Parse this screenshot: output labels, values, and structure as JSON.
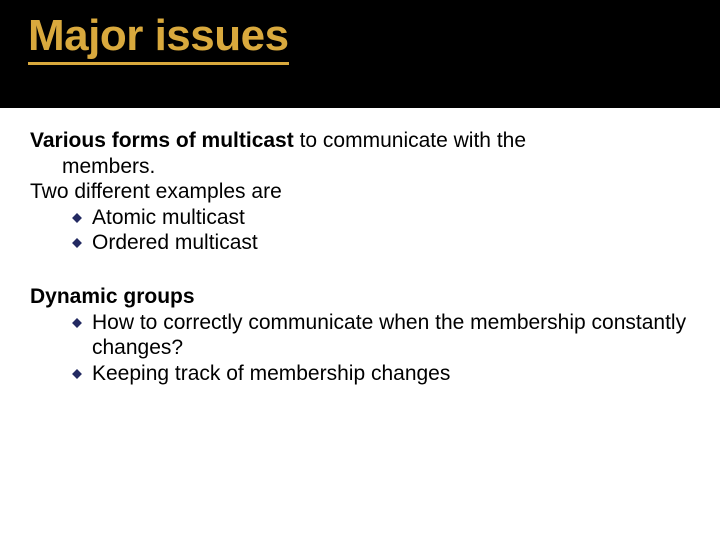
{
  "title": "Major issues",
  "section1": {
    "lead_bold": "Various forms of multicast",
    "lead_rest": " to communicate with the",
    "line2_indent": "members.",
    "line3": "Two different examples are",
    "bullets": [
      "Atomic multicast",
      "Ordered multicast"
    ]
  },
  "section2": {
    "heading": "Dynamic groups",
    "bullets": [
      "How to correctly communicate when the membership constantly changes?",
      "Keeping track of membership changes"
    ]
  },
  "colors": {
    "accent": "#d9a93d",
    "bullet": "#232a62"
  }
}
